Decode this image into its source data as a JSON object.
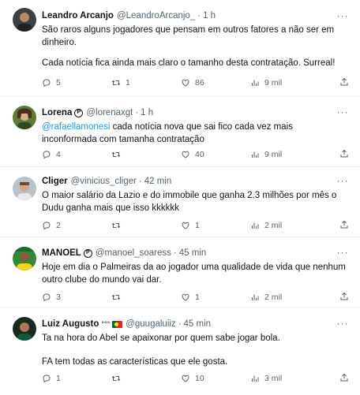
{
  "tweets": [
    {
      "name": "Leandro Arcanjo",
      "handle": "@LeandroArcanjo_",
      "time": "1 h",
      "badge": "",
      "lines": [
        "São raros alguns jogadores que pensam em outros fatores a não ser em",
        "dinheiro.",
        "",
        "Cada notícia fica ainda mais claro o tamanho desta contratação. Surreal!"
      ],
      "replies": "5",
      "retweets": "1",
      "likes": "86",
      "views": "9 mil"
    },
    {
      "name": "Lorena",
      "handle": "@lorenaxgt",
      "time": "1 h",
      "badge": "P",
      "mention": "@rafaellamonesi",
      "lines": [
        " cada notícia nova que sai fico cada vez mais",
        "inconformada com tamanha contratação"
      ],
      "replies": "4",
      "retweets": "",
      "likes": "40",
      "views": "9 mil"
    },
    {
      "name": "Cliger",
      "handle": "@vinicius_cliger",
      "time": "42 min",
      "badge": "",
      "lines": [
        "O maior salário da Lazio e do immobile que ganha 2.3 milhões por mês o",
        "Dudu ganha mais que isso kkkkkk"
      ],
      "replies": "2",
      "retweets": "",
      "likes": "1",
      "views": "2 mil"
    },
    {
      "name": "MANOEL",
      "handle": "@manoel_soaress",
      "time": "45 min",
      "badge": "P",
      "lines": [
        "Hoje em dia o Palmeiras da ao jogador uma qualidade de vida que nenhum",
        "outro clube do mundo vai dar."
      ],
      "replies": "3",
      "retweets": "",
      "likes": "1",
      "views": "2 mil"
    },
    {
      "name": "Luiz Augusto",
      "handle": "@guugaluiiz",
      "time": "45 min",
      "badge": "°°°",
      "lines": [
        "Ta na hora do Abel se apaixonar por quem sabe jogar bola.",
        "",
        "FA tem todas as características que ele gosta."
      ],
      "replies": "1",
      "retweets": "",
      "likes": "10",
      "views": "3 mil"
    }
  ],
  "icons": {
    "reply": "reply-icon",
    "retweet": "retweet-icon",
    "like": "like-icon",
    "views": "views-icon",
    "share": "share-icon",
    "more": "more-icon"
  },
  "colors": {
    "text": "#0f1419",
    "secondary": "#536471",
    "link": "#1d9bf0",
    "divider": "#eff3f4"
  }
}
